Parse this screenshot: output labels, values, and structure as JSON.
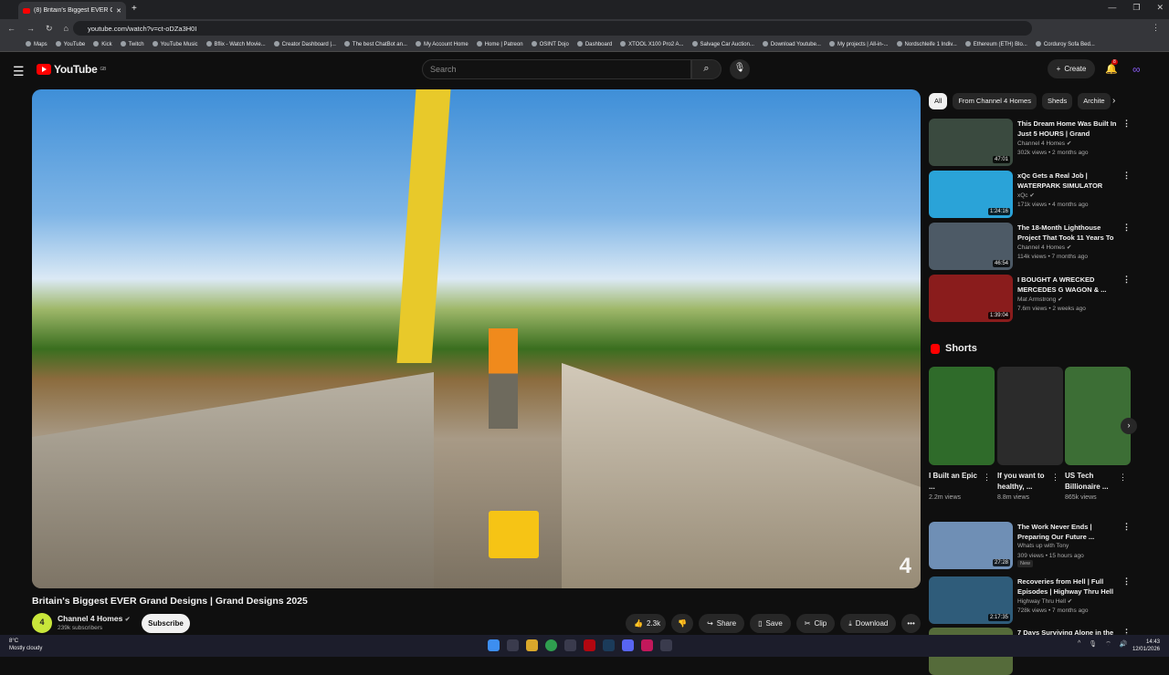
{
  "browser": {
    "tab_title": "(8) Britain's Biggest EVER G",
    "url": "youtube.com/watch?v=ct-oDZa3H0I",
    "bookmarks": [
      "Maps",
      "YouTube",
      "Kick",
      "Twitch",
      "YouTube Music",
      "Bflix - Watch Movie...",
      "Creator Dashboard |...",
      "The best ChatBot an...",
      "My Account Home",
      "Home | Patreon",
      "OSINT Dojo",
      "Dashboard",
      "XTOOL X100 Pro2 A...",
      "Salvage Car Auction...",
      "Download Youtube...",
      "My projects | All-in-...",
      "Nordschleife 1 Indiv...",
      "Ethereum (ETH) Blo...",
      "Corduroy Sofa Bed..."
    ]
  },
  "header": {
    "logo_text": "YouTube",
    "logo_country": "GB",
    "search_placeholder": "Search",
    "create_label": "Create",
    "notif_count": "8"
  },
  "video": {
    "title": "Britain's Biggest EVER Grand Designs | Grand Designs 2025",
    "watermark": "4"
  },
  "channel": {
    "avatar_text": "4",
    "name": "Channel 4 Homes",
    "subscribers": "239k subscribers",
    "subscribe_label": "Subscribe"
  },
  "actions": {
    "likes": "2.3k",
    "share": "Share",
    "save": "Save",
    "clip": "Clip",
    "download": "Download"
  },
  "chips": [
    "All",
    "From Channel 4 Homes",
    "Sheds",
    "Archite"
  ],
  "recommendations": [
    {
      "title": "This Dream Home Was Built In Just 5 HOURS | Grand Designs...",
      "channel": "Channel 4 Homes ✔",
      "meta": "302k views • 2 months ago",
      "duration": "47:01",
      "color": "#3a4a3f"
    },
    {
      "title": "xQc Gets a Real Job | WATERPARK SIMULATOR",
      "channel": "xQc ✔",
      "meta": "171k views • 4 months ago",
      "duration": "1:24:16",
      "color": "#2aa3d8"
    },
    {
      "title": "The 18-Month Lighthouse Project That Took 11 Years To ...",
      "channel": "Channel 4 Homes ✔",
      "meta": "114k views • 7 months ago",
      "duration": "46:54",
      "color": "#4d5a66"
    },
    {
      "title": "I BOUGHT A WRECKED MERCEDES G WAGON & ...",
      "channel": "Mat Armstrong ✔",
      "meta": "7.6m views • 2 weeks ago",
      "duration": "1:39:04",
      "color": "#8a1c1c"
    }
  ],
  "shorts": {
    "heading": "Shorts",
    "items": [
      {
        "title": "I Built an Epic ...",
        "views": "2.2m views",
        "color": "#2f6b2a"
      },
      {
        "title": "If you want to healthy, ...",
        "views": "8.8m views",
        "color": "#2b2b2b"
      },
      {
        "title": "US Tech Billionaire ...",
        "views": "865k views",
        "color": "#3c6e35"
      }
    ]
  },
  "more_recs": [
    {
      "title": "The Work Never Ends | Preparing Our Future ...",
      "channel": "Whats up with Tony",
      "meta": "309 views • 15 hours ago",
      "badge": "New",
      "duration": "27:28",
      "color": "#6f8fb5"
    },
    {
      "title": "Recoveries from Hell | Full Episodes | Highway Thru Hell",
      "channel": "Highway Thru Hell ✔",
      "meta": "728k views • 7 months ago",
      "badge": "",
      "duration": "2:17:35",
      "color": "#2f5c7a"
    },
    {
      "title": "7 Days Surviving Alone in the",
      "channel": "",
      "meta": "",
      "badge": "",
      "duration": "",
      "color": "#556b3a"
    }
  ],
  "taskbar": {
    "temp": "8°C",
    "weather": "Mostly cloudy",
    "time": "14:43",
    "date": "12/01/2026"
  }
}
